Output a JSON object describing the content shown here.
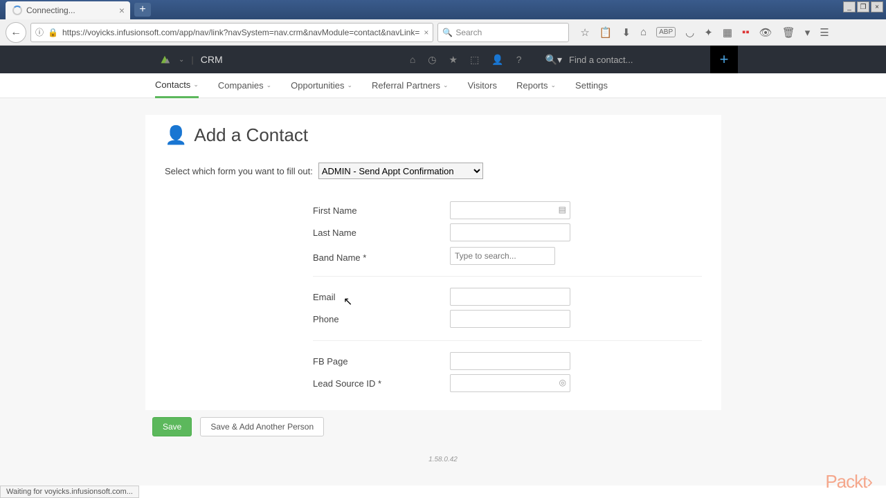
{
  "browser": {
    "tab_title": "Connecting...",
    "url": "https://voyicks.infusionsoft.com/app/nav/link?navSystem=nav.crm&navModule=contact&navLink=",
    "search_placeholder": "Search",
    "status_text": "Waiting for voyicks.infusionsoft.com..."
  },
  "header": {
    "app_name": "CRM",
    "search_placeholder": "Find a contact..."
  },
  "subnav": [
    {
      "label": "Contacts",
      "dropdown": true,
      "active": true
    },
    {
      "label": "Companies",
      "dropdown": true
    },
    {
      "label": "Opportunities",
      "dropdown": true
    },
    {
      "label": "Referral Partners",
      "dropdown": true
    },
    {
      "label": "Visitors",
      "dropdown": false
    },
    {
      "label": "Reports",
      "dropdown": true
    },
    {
      "label": "Settings",
      "dropdown": false
    }
  ],
  "page": {
    "title": "Add a Contact",
    "form_select_label": "Select which form you want to fill out:",
    "form_select_value": "ADMIN - Send Appt Confirmation",
    "fields": {
      "first_name": "First Name",
      "last_name": "Last Name",
      "band_name": "Band Name *",
      "band_name_placeholder": "Type to search...",
      "email": "Email",
      "phone": "Phone",
      "fb_page": "FB Page",
      "lead_source": "Lead Source ID *"
    },
    "buttons": {
      "save": "Save",
      "save_another": "Save & Add Another Person"
    },
    "version": "1.58.0.42"
  },
  "watermark": "Packt›"
}
